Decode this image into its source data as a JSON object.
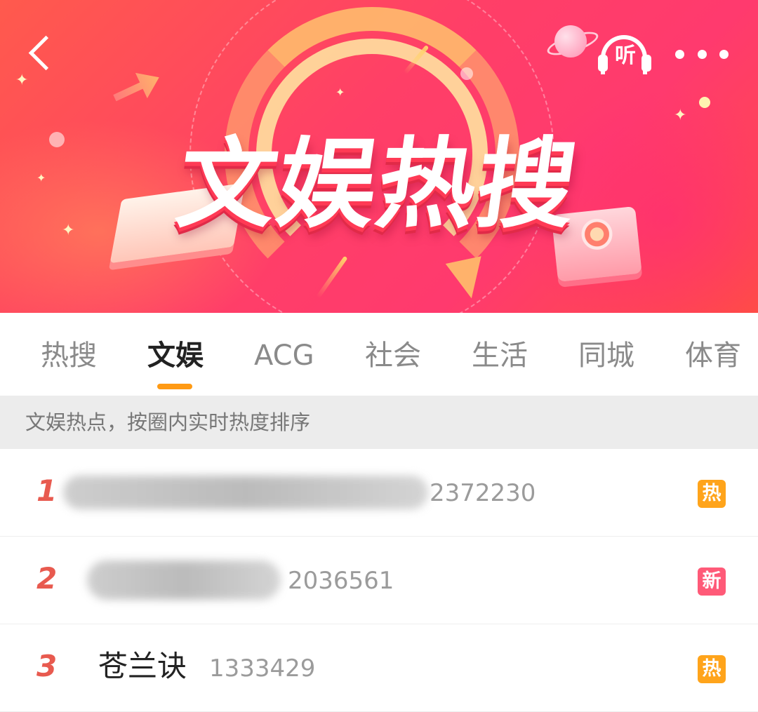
{
  "header": {
    "banner_title": "文娱热搜",
    "listen_label": "听"
  },
  "tabs": [
    {
      "label": "热搜",
      "active": false
    },
    {
      "label": "文娱",
      "active": true
    },
    {
      "label": "ACG",
      "active": false
    },
    {
      "label": "社会",
      "active": false
    },
    {
      "label": "生活",
      "active": false
    },
    {
      "label": "同城",
      "active": false
    },
    {
      "label": "体育",
      "active": false
    }
  ],
  "hint": "文娱热点，按圈内实时热度排序",
  "list": [
    {
      "rank": "1",
      "title": "",
      "count": "2372230",
      "badge": "热",
      "badge_type": "hot",
      "title_obscured": true
    },
    {
      "rank": "2",
      "title": "",
      "count": "2036561",
      "badge": "新",
      "badge_type": "new",
      "title_obscured": true
    },
    {
      "rank": "3",
      "title": "苍兰诀",
      "count": "1333429",
      "badge": "热",
      "badge_type": "hot",
      "title_obscured": false
    }
  ],
  "colors": {
    "accent": "#ff9a14",
    "rank": "#e85a4f",
    "badge_hot": "#ffa41b",
    "badge_new": "#ff5a78"
  }
}
